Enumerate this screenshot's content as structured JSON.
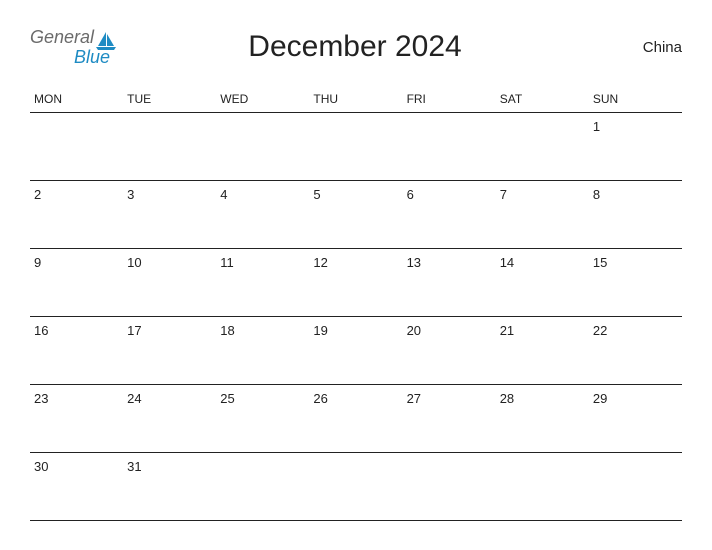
{
  "header": {
    "logo_top": "General",
    "logo_bottom": "Blue",
    "title": "December 2024",
    "region": "China"
  },
  "weekdays": [
    "MON",
    "TUE",
    "WED",
    "THU",
    "FRI",
    "SAT",
    "SUN"
  ],
  "weeks": [
    [
      "",
      "",
      "",
      "",
      "",
      "",
      "1"
    ],
    [
      "2",
      "3",
      "4",
      "5",
      "6",
      "7",
      "8"
    ],
    [
      "9",
      "10",
      "11",
      "12",
      "13",
      "14",
      "15"
    ],
    [
      "16",
      "17",
      "18",
      "19",
      "20",
      "21",
      "22"
    ],
    [
      "23",
      "24",
      "25",
      "26",
      "27",
      "28",
      "29"
    ],
    [
      "30",
      "31",
      "",
      "",
      "",
      "",
      ""
    ]
  ]
}
